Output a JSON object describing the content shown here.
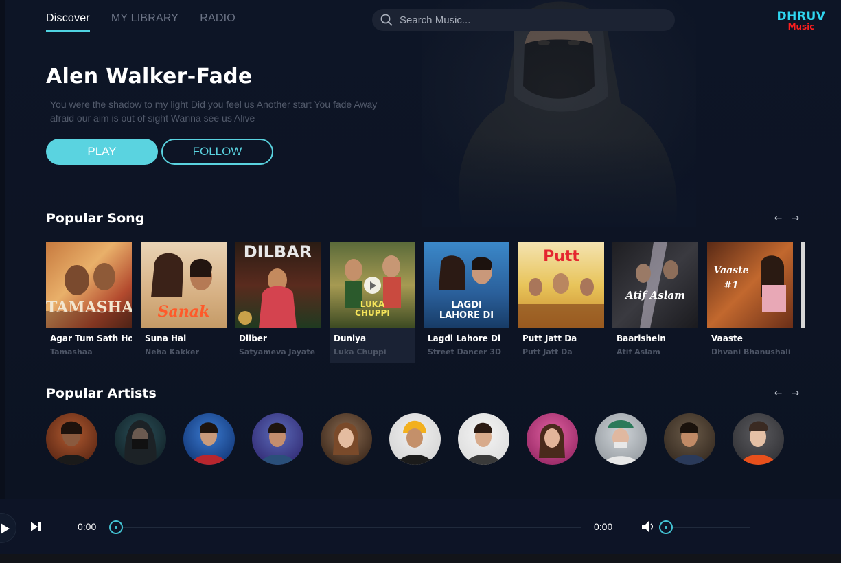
{
  "nav": {
    "tabs": [
      {
        "label": "Discover",
        "active": true
      },
      {
        "label": "MY LIBRARY",
        "active": false
      },
      {
        "label": "RADIO",
        "active": false
      }
    ]
  },
  "search": {
    "placeholder": "Search Music..."
  },
  "brand": {
    "name": "DHRUV",
    "sub": "Music"
  },
  "hero": {
    "title": "Alen Walker-Fade",
    "lyrics": "You were the shadow to my light Did you feel us Another start You fade Away afraid our aim is out of sight Wanna see us Alive",
    "play_label": "PLAY",
    "follow_label": "FOLLOW"
  },
  "popular_songs": {
    "title": "Popular Song",
    "prev_icon": "arrow-left-icon",
    "next_icon": "arrow-right-icon",
    "items": [
      {
        "title": "Agar Tum Sath Ho",
        "subtitle": "Tamashaa",
        "cover_text": "TAMASHA"
      },
      {
        "title": "Suna Hai",
        "subtitle": "Neha Kakker",
        "cover_text": "Sanak"
      },
      {
        "title": "Dilber",
        "subtitle": "Satyameva Jayate",
        "cover_text": "DILBAR"
      },
      {
        "title": "Duniya",
        "subtitle": "Luka Chuppi",
        "cover_text": "LUKA CHUPPI"
      },
      {
        "title": "Lagdi Lahore Di",
        "subtitle": "Street Dancer 3D",
        "cover_text": "LAGDI LAHORE DI"
      },
      {
        "title": "Putt Jatt Da",
        "subtitle": "Putt Jatt Da",
        "cover_text": "Putt"
      },
      {
        "title": "Baarishein",
        "subtitle": "Atif Aslam",
        "cover_text": "Atif Aslam"
      },
      {
        "title": "Vaaste",
        "subtitle": "Dhvani Bhanushali",
        "cover_text": "Vaaste #1"
      }
    ]
  },
  "popular_artists": {
    "title": "Popular Artists",
    "prev_icon": "arrow-left-icon",
    "next_icon": "arrow-right-icon"
  },
  "player": {
    "current_time": "0:00",
    "duration": "0:00",
    "progress": 0,
    "volume_level": 0
  },
  "colors": {
    "accent": "#5ad3e0",
    "brand": "#2fd6f0",
    "brand_sub": "#ff1f1f",
    "background": "#0d1526"
  }
}
